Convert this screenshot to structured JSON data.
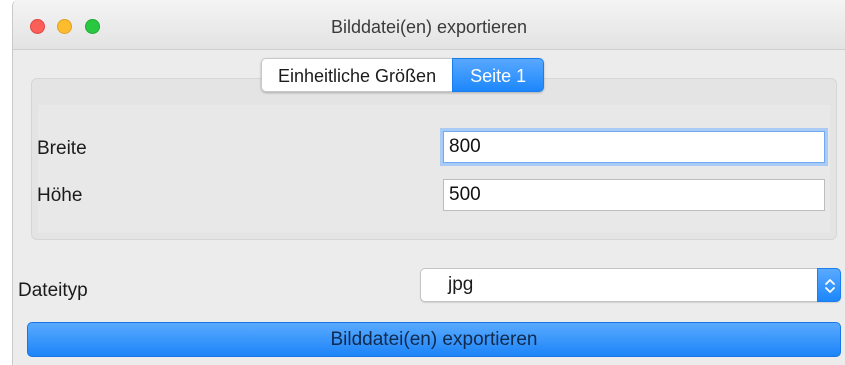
{
  "window": {
    "title": "Bilddatei(en) exportieren"
  },
  "tabs": [
    {
      "label": "Einheitliche Größen",
      "active": false
    },
    {
      "label": "Seite 1",
      "active": true
    }
  ],
  "form": {
    "width_label": "Breite",
    "width_value": "800",
    "height_label": "Höhe",
    "height_value": "500",
    "filetype_label": "Dateityp",
    "filetype_value": "jpg"
  },
  "actions": {
    "export_label": "Bilddatei(en) exportieren"
  },
  "colors": {
    "accent": "#1d87fb",
    "close": "#fc5f57",
    "minimize": "#fdbc2e",
    "maximize": "#28c840"
  }
}
